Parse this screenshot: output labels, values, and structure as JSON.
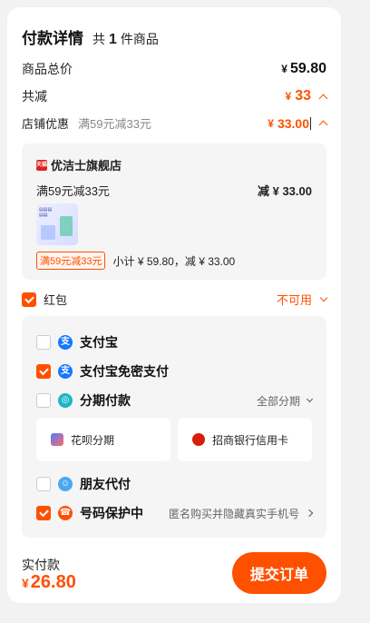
{
  "header": {
    "title": "付款详情",
    "count_prefix": "共",
    "count": "1",
    "count_suffix": "件商品"
  },
  "summary": {
    "total_label": "商品总价",
    "total_currency": "¥",
    "total_value": "59.80",
    "discount_label": "共减",
    "discount_currency": "¥",
    "discount_value": "33",
    "store_discount_label": "店铺优惠",
    "store_discount_rule": "满59元减33元",
    "store_discount_currency": "¥",
    "store_discount_value": "33.00"
  },
  "store": {
    "name": "优洁士旗舰店",
    "promo_text": "满59元减33元",
    "promo_amount_prefix": "减 ¥",
    "promo_amount": "33.00",
    "tag": "满59元减33元",
    "subtotal": "小计 ¥ 59.80，减 ¥ 33.00"
  },
  "red_packet": {
    "label": "红包",
    "status": "不可用",
    "checked": true
  },
  "payments": [
    {
      "label": "支付宝",
      "checked": false,
      "icon": "alipay-icon"
    },
    {
      "label": "支付宝免密支付",
      "checked": true,
      "icon": "alipay-icon"
    },
    {
      "label": "分期付款",
      "checked": false,
      "icon": "installment-icon",
      "right": "全部分期"
    },
    {
      "label": "朋友代付",
      "checked": false,
      "icon": "friend-pay-icon"
    },
    {
      "label": "号码保护中",
      "checked": true,
      "icon": "number-protect-icon",
      "right": "匿名购买并隐藏真实手机号"
    }
  ],
  "installments": [
    {
      "label": "花呗分期",
      "icon": "huabei-icon"
    },
    {
      "label": "招商银行信用卡",
      "icon": "cmb-icon"
    }
  ],
  "footer": {
    "total_label": "实付款",
    "currency": "¥",
    "total_value": "26.80",
    "submit_label": "提交订单"
  },
  "colors": {
    "accent": "#ff5000",
    "alipay": "#1677ff",
    "installment": "#1cb5c4"
  }
}
